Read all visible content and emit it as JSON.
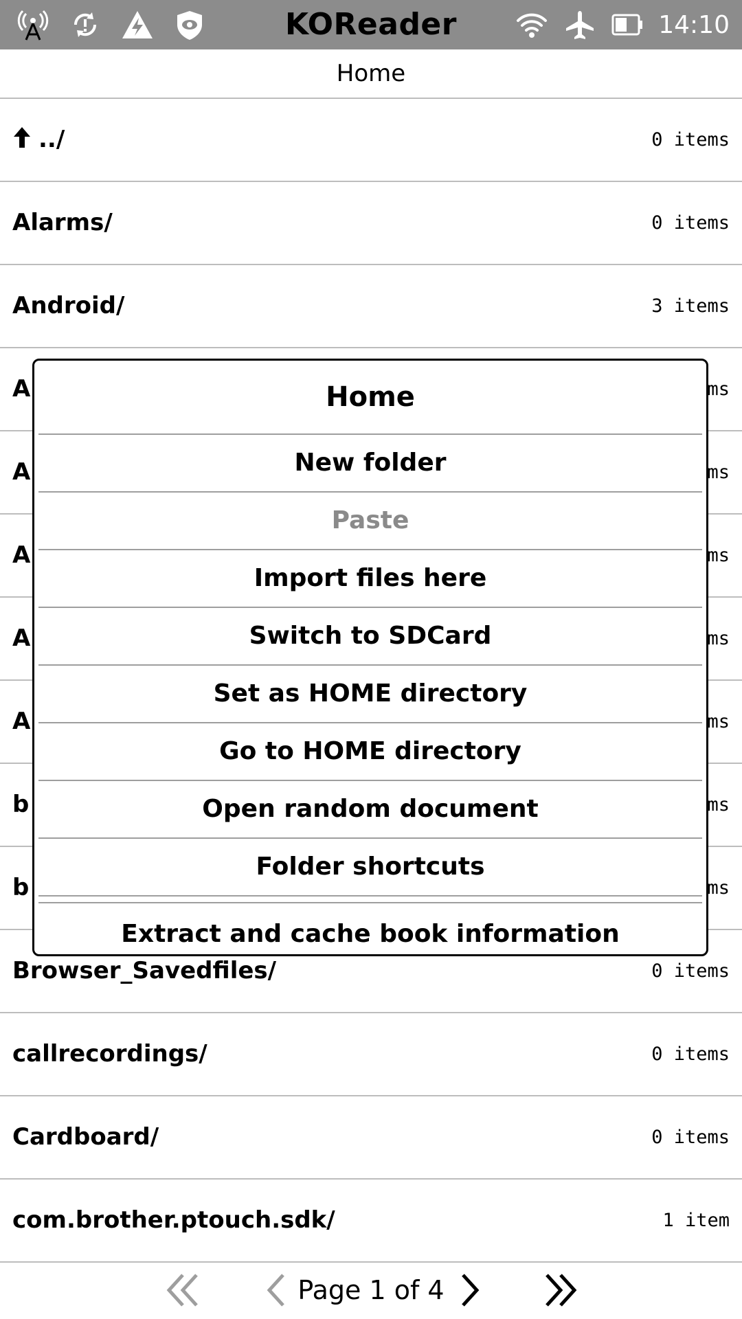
{
  "status_bar": {
    "app_title": "KOReader",
    "time": "14:10",
    "icons_left": [
      "antenna-icon",
      "sync-alert-icon",
      "warning-bolt-icon",
      "shield-eye-icon"
    ],
    "icons_right": [
      "wifi-icon",
      "airplane-icon",
      "battery-icon"
    ]
  },
  "header": {
    "title": "Home"
  },
  "file_list": [
    {
      "name": "../",
      "count": "0 items",
      "is_up": true
    },
    {
      "name": "Alarms/",
      "count": "0 items"
    },
    {
      "name": "Android/",
      "count": "3 items"
    },
    {
      "name": "A",
      "count": "ms"
    },
    {
      "name": "A",
      "count": "ms"
    },
    {
      "name": "A",
      "count": "ms"
    },
    {
      "name": "A",
      "count": "ms"
    },
    {
      "name": "A",
      "count": "ms"
    },
    {
      "name": "b",
      "count": "ms"
    },
    {
      "name": "b",
      "count": "ms"
    },
    {
      "name": "Browser_Savedfiles/",
      "count": "0 items"
    },
    {
      "name": "callrecordings/",
      "count": "0 items"
    },
    {
      "name": "Cardboard/",
      "count": "0 items"
    },
    {
      "name": "com.brother.ptouch.sdk/",
      "count": "1 item"
    }
  ],
  "popup": {
    "title": "Home",
    "items": [
      {
        "label": "New folder",
        "disabled": false
      },
      {
        "label": "Paste",
        "disabled": true
      },
      {
        "label": "Import files here",
        "disabled": false
      },
      {
        "label": "Switch to SDCard",
        "disabled": false
      },
      {
        "label": "Set as HOME directory",
        "disabled": false
      },
      {
        "label": "Go to HOME directory",
        "disabled": false
      },
      {
        "label": "Open random document",
        "disabled": false
      },
      {
        "label": "Folder shortcuts",
        "disabled": false
      },
      {
        "label": "Extract and cache book information",
        "disabled": false
      }
    ]
  },
  "pager": {
    "text": "Page 1 of 4"
  }
}
